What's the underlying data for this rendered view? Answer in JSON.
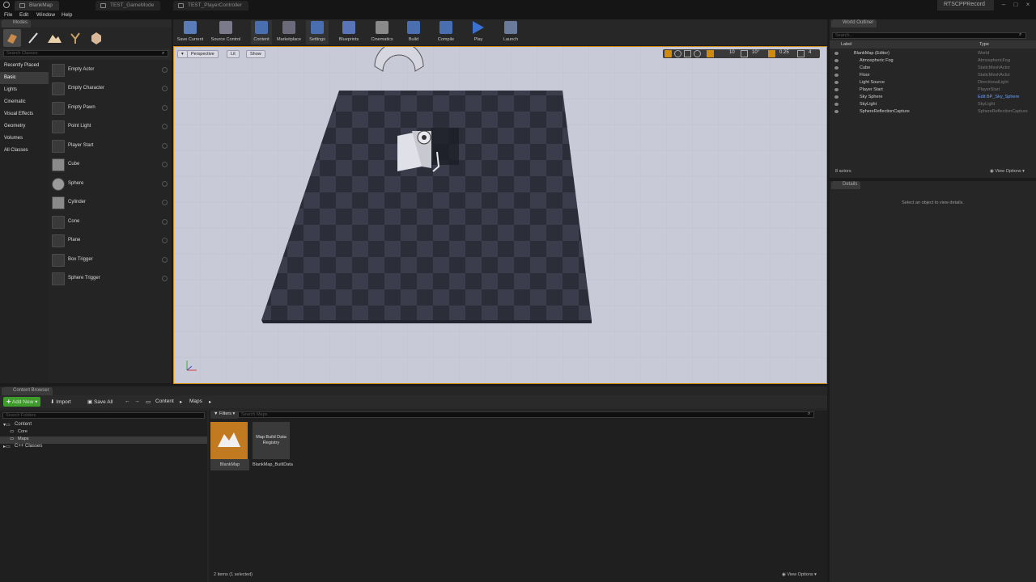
{
  "window": {
    "tabs": [
      {
        "label": "BlankMap",
        "active": true
      },
      {
        "label": "TEST_GameMode",
        "active": false
      },
      {
        "label": "TEST_PlayerController",
        "active": false
      }
    ],
    "project_name": "RTSCPPRecord",
    "menu": [
      "File",
      "Edit",
      "Window",
      "Help"
    ]
  },
  "modes": {
    "tab_label": "Modes",
    "search_placeholder": "Search Classes",
    "categories": [
      "Recently Placed",
      "Basic",
      "Lights",
      "Cinematic",
      "Visual Effects",
      "Geometry",
      "Volumes",
      "All Classes"
    ],
    "selected_category": "Basic",
    "items": [
      "Empty Actor",
      "Empty Character",
      "Empty Pawn",
      "Point Light",
      "Player Start",
      "Cube",
      "Sphere",
      "Cylinder",
      "Cone",
      "Plane",
      "Box Trigger",
      "Sphere Trigger"
    ]
  },
  "toolbar": {
    "buttons": [
      "Save Current",
      "Source Control",
      "Content",
      "Marketplace",
      "Settings",
      "Blueprints",
      "Cinematics",
      "Build",
      "Compile",
      "Play",
      "Launch"
    ]
  },
  "viewport": {
    "perspective_label": "Perspective",
    "lit_label": "Lit",
    "show_label": "Show",
    "grid_snap": "10",
    "rotation_snap": "10°",
    "scale_snap": "0.25",
    "camera_speed": "4"
  },
  "outliner": {
    "tab_label": "World Outliner",
    "search_placeholder": "Search...",
    "col_label": "Label",
    "col_type": "Type",
    "rows": [
      {
        "label": "BlankMap (Editor)",
        "type": "World",
        "indent": 0
      },
      {
        "label": "Atmospheric Fog",
        "type": "AtmosphericFog",
        "indent": 1
      },
      {
        "label": "Cube",
        "type": "StaticMeshActor",
        "indent": 1
      },
      {
        "label": "Floor",
        "type": "StaticMeshActor",
        "indent": 1
      },
      {
        "label": "Light Source",
        "type": "DirectionalLight",
        "indent": 1
      },
      {
        "label": "Player Start",
        "type": "PlayerStart",
        "indent": 1
      },
      {
        "label": "Sky Sphere",
        "type": "Edit BP_Sky_Sphere",
        "indent": 1
      },
      {
        "label": "SkyLight",
        "type": "SkyLight",
        "indent": 1
      },
      {
        "label": "SphereReflectionCapture",
        "type": "SphereReflectionCapture",
        "indent": 1
      }
    ],
    "actor_count": "8 actors",
    "view_options": "View Options"
  },
  "details": {
    "tab_label": "Details",
    "empty_message": "Select an object to view details."
  },
  "content_browser": {
    "tab_label": "Content Browser",
    "add_new": "Add New",
    "import": "Import",
    "save_all": "Save All",
    "breadcrumb": [
      "Content",
      "Maps"
    ],
    "folder_search_placeholder": "Search Folders",
    "filters_label": "Filters",
    "asset_search_placeholder": "Search Maps",
    "tree": [
      {
        "label": "Content",
        "indent": 0
      },
      {
        "label": "Core",
        "indent": 1
      },
      {
        "label": "Maps",
        "indent": 1
      },
      {
        "label": "C++ Classes",
        "indent": 0
      }
    ],
    "assets": [
      {
        "name": "BlankMap",
        "thumb_label": ""
      },
      {
        "name": "BlankMap_BuiltData",
        "thumb_label": "Map Build Data Registry"
      }
    ],
    "status": "2 items (1 selected)",
    "view_options": "View Options"
  },
  "colors": {
    "accent_green": "#3e9c2a",
    "selection_orange": "#d08a10",
    "link_blue": "#6aa0ff"
  }
}
